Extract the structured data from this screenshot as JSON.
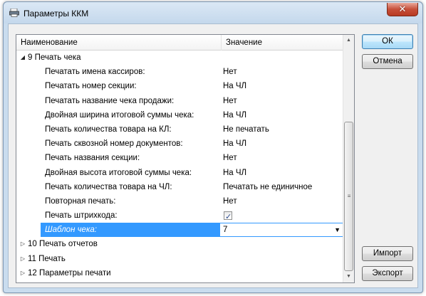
{
  "window": {
    "title": "Параметры ККМ"
  },
  "grid": {
    "header": {
      "name": "Наименование",
      "value": "Значение"
    },
    "group_expanded": "9 Печать чека",
    "properties": [
      {
        "name": "Печатать имена кассиров:",
        "value": "Нет"
      },
      {
        "name": "Печатать номер секции:",
        "value": "На ЧЛ"
      },
      {
        "name": "Печатать название чека продажи:",
        "value": "Нет"
      },
      {
        "name": "Двойная ширина итоговой суммы чека:",
        "value": "На ЧЛ"
      },
      {
        "name": "Печать количества товара на КЛ:",
        "value": "Не печатать"
      },
      {
        "name": "Печать сквозной номер документов:",
        "value": "На ЧЛ"
      },
      {
        "name": "Печать названия секции:",
        "value": "Нет"
      },
      {
        "name": "Двойная высота итоговой суммы чека:",
        "value": "На ЧЛ"
      },
      {
        "name": "Печать количества товара на ЧЛ:",
        "value": "Печатать не единичное"
      },
      {
        "name": "Повторная печать:",
        "value": "Нет"
      }
    ],
    "checkbox_row": {
      "name": "Печать штрихкода:",
      "checked": true
    },
    "selected_row": {
      "name": "Шаблон чека:",
      "value": "7"
    },
    "collapsed_groups": [
      "10 Печать отчетов",
      "11 Печать",
      "12 Параметры печати"
    ]
  },
  "buttons": {
    "ok": "ОК",
    "cancel": "Отмена",
    "import": "Импорт",
    "export": "Экспорт"
  },
  "icons": {
    "expanded": "triangle-down-icon",
    "collapsed": "triangle-right-icon",
    "dropdown": "chevron-down-icon"
  },
  "colors": {
    "selection": "#3399ff",
    "close_button": "#c7503a"
  }
}
